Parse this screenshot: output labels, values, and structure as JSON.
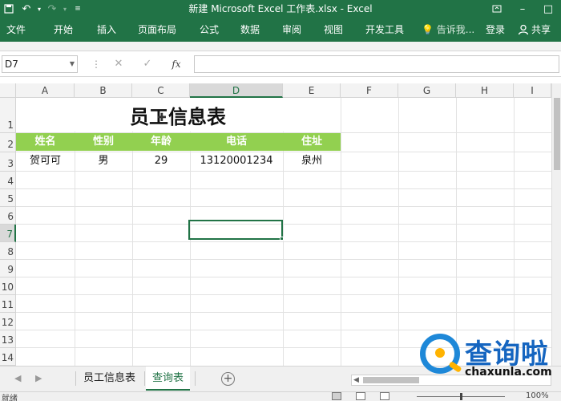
{
  "window": {
    "title": "新建 Microsoft Excel 工作表.xlsx - Excel",
    "quick_access": [
      "save-icon",
      "undo-icon",
      "redo-icon",
      "customize-icon"
    ],
    "controls": [
      "restore-ribbon-icon",
      "minimize-icon",
      "maximize-icon",
      "close-icon"
    ]
  },
  "ribbon": {
    "tabs": [
      "文件",
      "开始",
      "插入",
      "页面布局",
      "公式",
      "数据",
      "审阅",
      "视图",
      "开发工具"
    ],
    "tell_me": "告诉我...",
    "login": "登录",
    "share": "共享"
  },
  "formula_bar": {
    "name_box": "D7",
    "cancel_icon": "✕",
    "enter_icon": "✓",
    "fx_label": "fx",
    "formula": ""
  },
  "grid": {
    "columns": [
      "A",
      "B",
      "C",
      "D",
      "E",
      "F",
      "G",
      "H",
      "I"
    ],
    "rows": [
      "1",
      "2",
      "3",
      "4",
      "5",
      "6",
      "7",
      "8",
      "9",
      "10",
      "11",
      "12",
      "13",
      "14"
    ],
    "selected_cell": "D7",
    "title": "员工信息表",
    "headers": [
      "姓名",
      "性别",
      "年龄",
      "电话",
      "住址"
    ],
    "row3": [
      "贺可可",
      "男",
      "29",
      "13120001234",
      "泉州"
    ],
    "header_fill": "#92d050",
    "accent": "#217346"
  },
  "sheets": {
    "tabs": [
      "员工信息表",
      "查询表"
    ],
    "active": "查询表",
    "add_icon": "+"
  },
  "watermark": {
    "text": "查询啦",
    "url": "chaxunla.com"
  },
  "status": {
    "ready": "就绪",
    "zoom": "100%"
  }
}
